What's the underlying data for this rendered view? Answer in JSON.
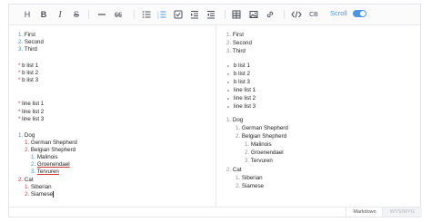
{
  "toolbar": {
    "heading": "H",
    "bold": "B",
    "italic": "I",
    "strike": "S",
    "quote": "66",
    "codeblock": "CB",
    "scroll_label": "Scroll",
    "icons": [
      "heading-icon",
      "bold-icon",
      "italic-icon",
      "strike-icon",
      "hr-icon",
      "quote-icon",
      "bullet-list-icon",
      "ordered-list-icon",
      "task-icon",
      "indent-icon",
      "outdent-icon",
      "table-icon",
      "image-icon",
      "link-icon",
      "code-icon",
      "codeblock-icon"
    ],
    "accent_color": "#4b96e6"
  },
  "markdown": {
    "ol1": [
      {
        "num": "1.",
        "text": "First"
      },
      {
        "num": "2.",
        "text": "Second"
      },
      {
        "num": "3.",
        "text": "Third"
      }
    ],
    "ul_b": [
      {
        "mark": "*",
        "text": "b list 1"
      },
      {
        "mark": "*",
        "text": "b list 2"
      },
      {
        "mark": "*",
        "text": "b list 3"
      }
    ],
    "ul_line": [
      {
        "mark": "*",
        "text": "line list 1"
      },
      {
        "mark": "*",
        "text": "line list 2"
      },
      {
        "mark": "*",
        "text": "line list 3"
      }
    ],
    "nested": [
      {
        "num": "1.",
        "text": "Dog"
      },
      {
        "num": "1.",
        "text": "German Shepherd"
      },
      {
        "num": "2.",
        "text": "Belgian Shepherd"
      },
      {
        "num": "1.",
        "text": "Malinois"
      },
      {
        "num": "2.",
        "text": "Groenendael"
      },
      {
        "num": "3.",
        "text": "Tervuren"
      },
      {
        "num": "2.",
        "text": "Cat"
      },
      {
        "num": "1.",
        "text": "Siberian"
      },
      {
        "num": "2.",
        "text": "Siamese"
      }
    ]
  },
  "preview": {
    "ol1": [
      {
        "num": "1.",
        "text": "First"
      },
      {
        "num": "2.",
        "text": "Second"
      },
      {
        "num": "3.",
        "text": "Third"
      }
    ],
    "ul": [
      "b list 1",
      "b list 2",
      "b list 3",
      "line list 1",
      "line list 2",
      "line list 3"
    ],
    "nested": [
      {
        "num": "1.",
        "text": "Dog"
      },
      {
        "num": "1.",
        "text": "German Shepherd"
      },
      {
        "num": "2.",
        "text": "Belgian Shepherd"
      },
      {
        "num": "1.",
        "text": "Malinois"
      },
      {
        "num": "2.",
        "text": "Groenendael"
      },
      {
        "num": "3.",
        "text": "Tervuren"
      },
      {
        "num": "2.",
        "text": "Cat"
      },
      {
        "num": "1.",
        "text": "Siberian"
      },
      {
        "num": "2.",
        "text": "Siamese"
      }
    ]
  },
  "footer": {
    "markdown_tab": "Markdown",
    "wysiwyg_tab": "WYSIWYG"
  }
}
